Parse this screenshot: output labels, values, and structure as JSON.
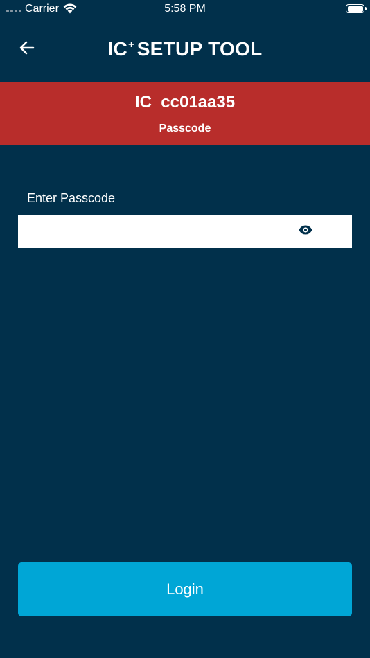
{
  "status_bar": {
    "carrier": "Carrier",
    "time": "5:58 PM",
    "signal_icon": "signal-dots-icon",
    "wifi_icon": "wifi-icon",
    "battery_icon": "battery-icon",
    "battery_level": 1.0
  },
  "nav": {
    "back_icon": "arrow-left-icon",
    "title_prefix": "IC",
    "title_superscript": "+",
    "title_suffix": "SETUP TOOL"
  },
  "device": {
    "name": "IC_cc01aa35",
    "subtitle": "Passcode"
  },
  "form": {
    "label": "Enter Passcode",
    "value": "",
    "placeholder": "",
    "eye_icon": "eye-icon"
  },
  "actions": {
    "login_label": "Login"
  },
  "colors": {
    "background": "#01304b",
    "banner": "#b82d2b",
    "button": "#00a6d6",
    "field": "#ffffff"
  }
}
